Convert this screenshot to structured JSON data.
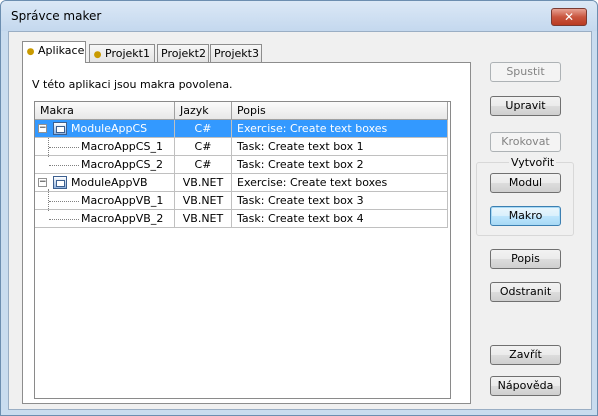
{
  "window": {
    "title": "Správce maker",
    "close_label": "✕"
  },
  "tabs": [
    {
      "label": "Aplikace"
    },
    {
      "label": "Projekt1"
    },
    {
      "label": "Projekt2"
    },
    {
      "label": "Projekt3"
    }
  ],
  "panel": {
    "info_text": "V této aplikaci jsou makra povolena."
  },
  "grid": {
    "columns": [
      "Makra",
      "Jazyk",
      "Popis"
    ],
    "rows": [
      {
        "name": "ModuleAppCS",
        "lang": "C#",
        "desc": "Exercise: Create text boxes"
      },
      {
        "name": "MacroAppCS_1",
        "lang": "C#",
        "desc": "Task: Create text box 1"
      },
      {
        "name": "MacroAppCS_2",
        "lang": "C#",
        "desc": "Task: Create text box 2"
      },
      {
        "name": "ModuleAppVB",
        "lang": "VB.NET",
        "desc": "Exercise: Create text boxes"
      },
      {
        "name": "MacroAppVB_1",
        "lang": "VB.NET",
        "desc": "Task: Create text box 3"
      },
      {
        "name": "MacroAppVB_2",
        "lang": "VB.NET",
        "desc": "Task: Create text box 4"
      }
    ],
    "selected_row": "ModuleAppCS",
    "expander_symbol": "−"
  },
  "buttons": {
    "spustit": "Spustit",
    "upravit": "Upravit",
    "krokovat": "Krokovat",
    "create_group_label": "Vytvořit",
    "modul": "Modul",
    "makro": "Makro",
    "popis": "Popis",
    "odstranit": "Odstranit",
    "zavrit": "Zavřít",
    "napoveda": "Nápověda"
  },
  "colors": {
    "selection": "#3399ff",
    "window_frame": "#c9dcef",
    "close_button": "#c9553f"
  },
  "icons": {
    "tab_icon": "lightbulb-icon",
    "module_icon": "module-icon",
    "close": "close-icon"
  }
}
